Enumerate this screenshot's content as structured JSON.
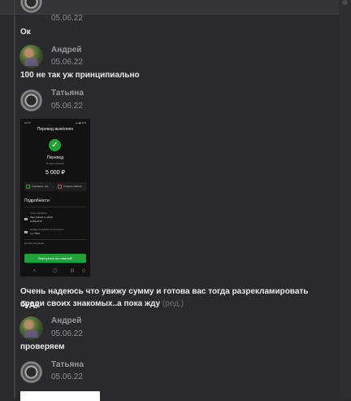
{
  "messages": [
    {
      "author": "",
      "date": "05.06.22",
      "text": "Ок"
    },
    {
      "author": "Андрей",
      "date": "05.06.22",
      "text": "100 не так уж принципиально"
    },
    {
      "author": "Татьяна",
      "date": "05.06.22"
    },
    {
      "author": "",
      "date": "",
      "text_line1": "Очень надеюсь что увижу сумму и готова вас тогда разрекламировать буду",
      "text_line2": "среди своих знакомых..а пока жду",
      "edited": "(ред.)"
    },
    {
      "author": "Андрей",
      "date": "05.06.22",
      "text": "проверяем"
    },
    {
      "author": "Татьяна",
      "date": "05.06.22"
    }
  ],
  "phone": {
    "status_left": "14:27",
    "status_right": "◂ ▴ ▮ 41%",
    "title": "Перевод выполнен",
    "check": "✓",
    "label": "Перевод",
    "sub": "В одно касание",
    "amount": "5 000 ₽",
    "btn_save": "Сохранить чек",
    "btn_template": "Создать шаблон",
    "details_title": "Подробности",
    "row1_small": "Счёт списания",
    "row1_text": "Мир Classic ••••2113",
    "row1_text2": "8 366,42 ₽",
    "row2_small": "Номер телефона получателя",
    "row2_text": "•••• 7544",
    "row3_small": "Детали операции",
    "green_btn": "Вернуться на главный",
    "nav": [
      "<",
      "◯",
      "|||",
      "⟨⟩"
    ]
  },
  "colors": {
    "background": "#2a2a2c",
    "text": "#e9e9ea",
    "muted": "#8e8e92",
    "accent_green": "#21a038"
  }
}
